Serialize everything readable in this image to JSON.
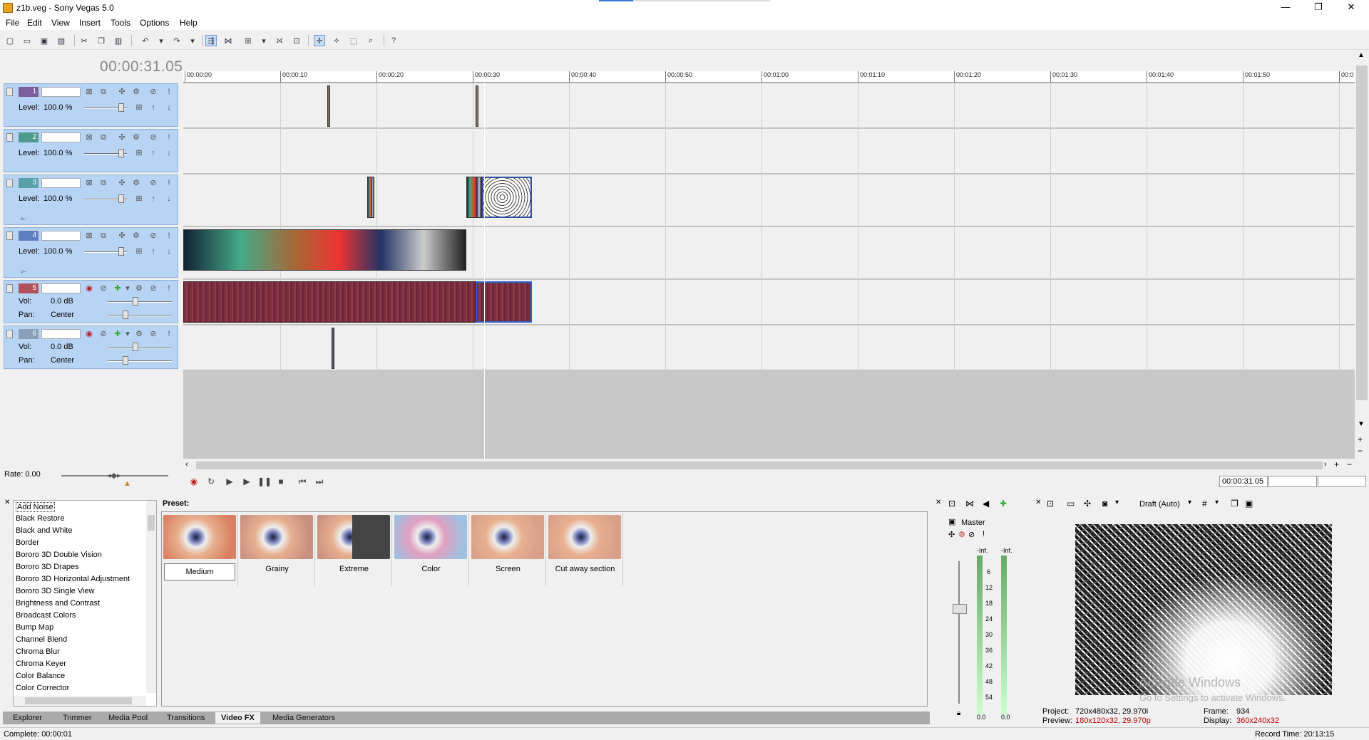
{
  "window": {
    "title": "z1b.veg - Sony Vegas 5.0",
    "minimize": "—",
    "maximize": "❐",
    "close": "✕"
  },
  "menu": [
    "File",
    "Edit",
    "View",
    "Insert",
    "Tools",
    "Options",
    "Help"
  ],
  "timecode": "00:00:31.05",
  "ruler_ticks": [
    "00:00:00",
    "00:00:10",
    "00:00:20",
    "00:00:30",
    "00:00:40",
    "00:00:50",
    "00:01:00",
    "00:01:10",
    "00:01:20",
    "00:01:30",
    "00:01:40",
    "00:01:50",
    "00:0"
  ],
  "tracks": [
    {
      "num": "1",
      "type": "video",
      "level_label": "Level:",
      "level": "100.0 %",
      "color": "#7a5f9c"
    },
    {
      "num": "2",
      "type": "video",
      "level_label": "Level:",
      "level": "100.0 %",
      "color": "#4f9a8c"
    },
    {
      "num": "3",
      "type": "video",
      "level_label": "Level:",
      "level": "100.0 %",
      "color": "#5aa0a8"
    },
    {
      "num": "4",
      "type": "video",
      "level_label": "Level:",
      "level": "100.0 %",
      "color": "#5c7fc0"
    },
    {
      "num": "5",
      "type": "audio",
      "vol_label": "Vol:",
      "vol": "0.0 dB",
      "pan_label": "Pan:",
      "pan": "Center",
      "color": "#b0505a"
    },
    {
      "num": "6",
      "type": "audio",
      "vol_label": "Vol:",
      "vol": "0.0 dB",
      "pan_label": "Pan:",
      "pan": "Center",
      "color": "#8aa0b8"
    }
  ],
  "rate": "Rate: 0.00",
  "transport": {
    "time_a": "00:00:31.05",
    "time_b": "",
    "time_c": ""
  },
  "fx_list": [
    "Add Noise",
    "Black Restore",
    "Black and White",
    "Border",
    "Bororo 3D Double Vision",
    "Bororo 3D Drapes",
    "Bororo 3D Horizontal Adjustment",
    "Bororo 3D Single View",
    "Brightness and Contrast",
    "Broadcast Colors",
    "Bump Map",
    "Channel Blend",
    "Chroma Blur",
    "Chroma Keyer",
    "Color Balance",
    "Color Corrector"
  ],
  "preset_label": "Preset:",
  "presets": [
    "Medium",
    "Grainy",
    "Extreme",
    "Color",
    "Screen",
    "Cut away section"
  ],
  "tabs": [
    "Explorer",
    "Trimmer",
    "Media Pool",
    "Transitions",
    "Video FX",
    "Media Generators"
  ],
  "mixer": {
    "master": "Master",
    "inf_l": "-Inf.",
    "inf_r": "-Inf.",
    "scale": [
      "6",
      "12",
      "18",
      "24",
      "30",
      "36",
      "42",
      "48",
      "54"
    ],
    "val_l": "0.0",
    "val_r": "0.0"
  },
  "preview": {
    "quality": "Draft (Auto)",
    "project_label": "Project:",
    "project": "720x480x32, 29.970i",
    "preview_label": "Preview:",
    "preview": "180x120x32, 29.970p",
    "frame_label": "Frame:",
    "frame": "934",
    "display_label": "Display:",
    "display": "360x240x32",
    "record_time": "Record Time: 20:13:15"
  },
  "watermark": {
    "line1": "Activate Windows",
    "line2": "Go to Settings to activate Windows."
  },
  "status": "Complete: 00:00:01"
}
